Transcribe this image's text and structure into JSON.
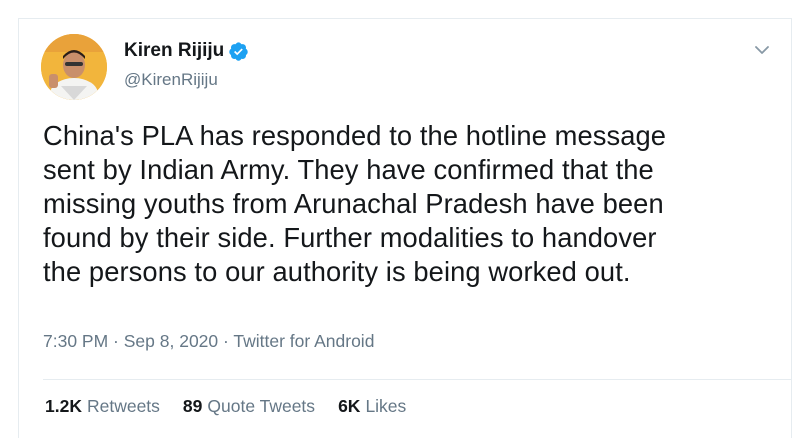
{
  "author": {
    "name": "Kiren Rijiju",
    "handle": "@KirenRijiju",
    "verified": true
  },
  "tweet": {
    "lines": [
      "China's PLA has responded to the hotline message",
      "sent by Indian Army. They have confirmed that the",
      "missing youths from Arunachal Pradesh have been",
      "found by their side. Further modalities to handover",
      "the persons to our authority is being worked out."
    ]
  },
  "meta": {
    "time": "7:30 PM",
    "sep1": " · ",
    "date": "Sep 8, 2020",
    "sep2": " · ",
    "source": "Twitter for Android"
  },
  "stats": {
    "retweets": {
      "count": "1.2K",
      "label": "Retweets"
    },
    "quotes": {
      "count": "89",
      "label": "Quote Tweets"
    },
    "likes": {
      "count": "6K",
      "label": "Likes"
    }
  },
  "colors": {
    "accent": "#1da1f2",
    "secondary_text": "#657786",
    "border": "#e6ecf0"
  },
  "icons": {
    "verified": "verified-badge-icon",
    "menu": "chevron-down-icon"
  }
}
